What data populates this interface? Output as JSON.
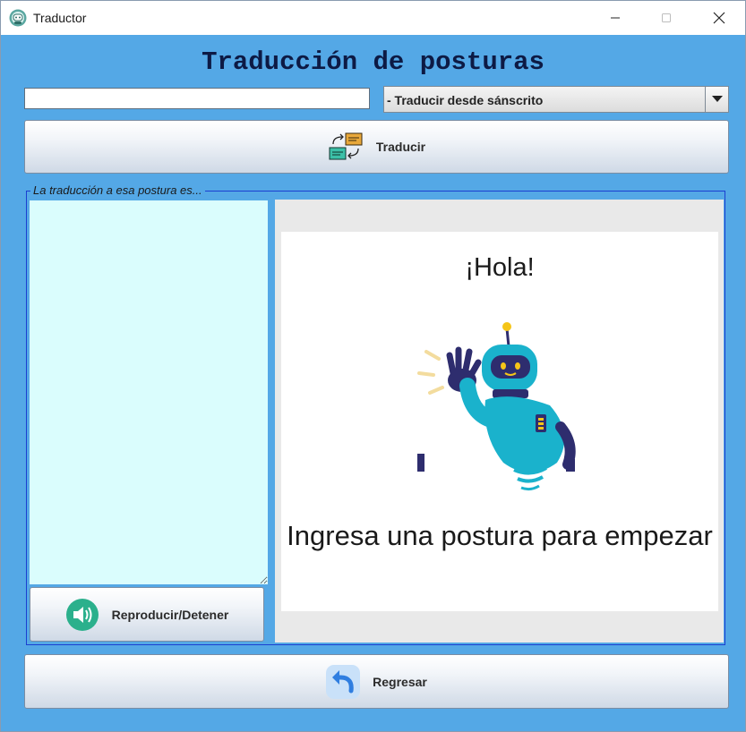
{
  "window": {
    "title": "Traductor",
    "app_icon": "robot-face-icon",
    "controls": [
      "minimize-icon",
      "maximize-icon",
      "close-icon"
    ]
  },
  "header": {
    "title": "Traducción de posturas"
  },
  "input": {
    "value": "",
    "placeholder": ""
  },
  "direction_select": {
    "selected": "- Traducir desde sánscrito",
    "icon": "chevron-down-icon"
  },
  "translate_button": {
    "label": "Traducir",
    "icon": "translate-cards-icon"
  },
  "result_group": {
    "legend": "La traducción a esa postura es...",
    "text": ""
  },
  "audio_button": {
    "label": "Reproducir/Detener",
    "icon": "speaker-icon"
  },
  "preview": {
    "greeting": "¡Hola!",
    "prompt": "Ingresa una postura para empezar",
    "image": "waving-robot-illustration"
  },
  "back_button": {
    "label": "Regresar",
    "icon": "undo-arrow-icon"
  },
  "colors": {
    "window_bg": "#54a8e6",
    "text_area_bg": "#dafdfd",
    "title_color": "#0d1a44",
    "group_border": "#1b3fd0",
    "robot_body": "#1ab2cc",
    "robot_dark": "#2e2d6e"
  }
}
